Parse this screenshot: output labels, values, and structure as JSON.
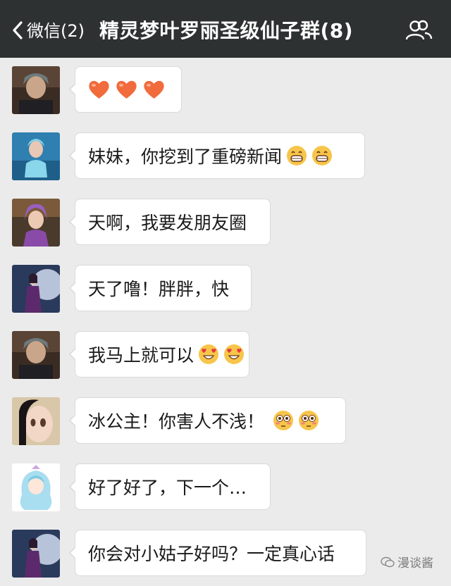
{
  "header": {
    "back_label": "微信(2)",
    "title": "精灵梦叶罗丽圣级仙子群(8)"
  },
  "messages": [
    {
      "avatar": "avatar-dark-hair-fairy",
      "text": "",
      "emojis": [
        "heart-icon",
        "heart-icon",
        "heart-icon"
      ]
    },
    {
      "avatar": "avatar-blue-hair-fairy",
      "text": "妹妹，你挖到了重磅新闻",
      "emojis": [
        "grinning-face-icon",
        "grinning-face-icon"
      ]
    },
    {
      "avatar": "avatar-pink-hair-fairy",
      "text": "天啊，我要发朋友圈",
      "emojis": []
    },
    {
      "avatar": "avatar-moon-fairy",
      "text": "天了噜！胖胖，快",
      "emojis": []
    },
    {
      "avatar": "avatar-dark-hair-fairy",
      "text": "我马上就可以",
      "emojis": [
        "heart-eyes-face-icon",
        "heart-eyes-face-icon"
      ]
    },
    {
      "avatar": "avatar-black-hair-girl",
      "text": "冰公主！你害人不浅！",
      "emojis": [
        "flushed-face-icon",
        "flushed-face-icon"
      ]
    },
    {
      "avatar": "avatar-white-hair-fairy",
      "text": "好了好了，下一个…",
      "emojis": []
    },
    {
      "avatar": "avatar-moon-fairy",
      "text": "你会对小姑子好吗？一定真心话",
      "emojis": []
    }
  ],
  "watermark": "漫谈酱",
  "colors": {
    "topbar": "#2e3132",
    "background": "#ebebeb",
    "bubble": "#ffffff"
  }
}
